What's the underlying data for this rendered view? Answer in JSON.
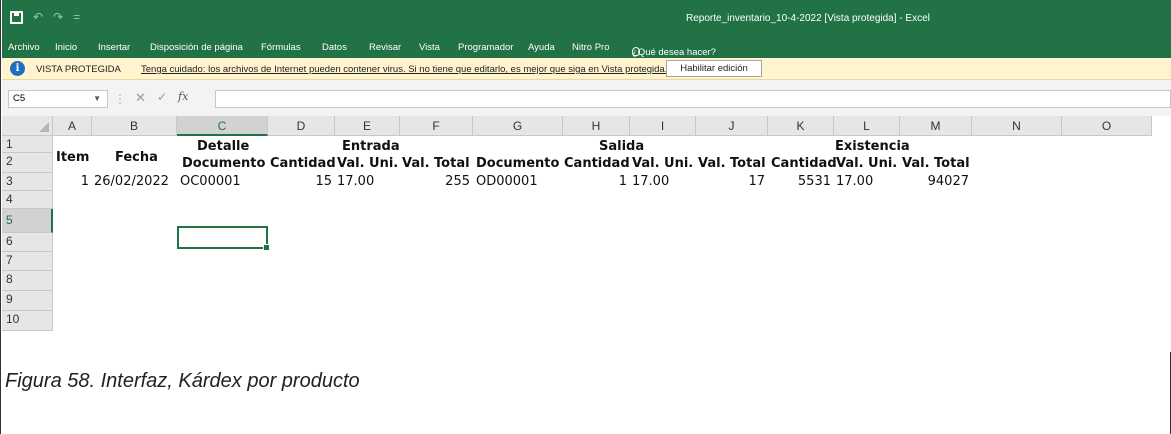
{
  "title_bar": {
    "document_title": "Reporte_inventario_10-4-2022  [Vista protegida]  -  Excel",
    "qat_undo": "↶",
    "qat_redo": "↷",
    "qat_more": "="
  },
  "ribbon_tabs": [
    "Archivo",
    "Inicio",
    "Insertar",
    "Disposición de página",
    "Fórmulas",
    "Datos",
    "Revisar",
    "Vista",
    "Programador",
    "Ayuda",
    "Nitro Pro",
    "¿Qué desea hacer?"
  ],
  "protected_view": {
    "label": "VISTA PROTEGIDA",
    "message": "Tenga cuidado: los archivos de Internet pueden contener virus. Si no tiene que editarlo, es mejor que siga en Vista protegida.",
    "button": "Habilitar edición"
  },
  "formula_bar": {
    "name_box": "C5",
    "formula": ""
  },
  "columns": [
    "A",
    "B",
    "C",
    "D",
    "E",
    "F",
    "G",
    "H",
    "I",
    "J",
    "K",
    "L",
    "M",
    "N",
    "O"
  ],
  "rows": [
    "1",
    "2",
    "3",
    "4",
    "5",
    "6",
    "7",
    "8",
    "9",
    "10"
  ],
  "selected_cell": "C5",
  "sheet": {
    "h_item": "Item",
    "h_fecha": "Fecha",
    "h_detalle": "Detalle",
    "h_entrada": "Entrada",
    "h_salida": "Salida",
    "h_existencia": "Existencia",
    "h_documento_1": "Documento",
    "h_cantidad_1": "Cantidad",
    "h_valuni_1": "Val. Uni.",
    "h_valtotal_1": "Val. Total",
    "h_documento_2": "Documento",
    "h_cantidad_2": "Cantidad",
    "h_valuni_2": "Val. Uni.",
    "h_valtotal_2": "Val. Total",
    "h_cantidad_3": "Cantidad",
    "h_valuni_3": "Val. Uni.",
    "h_valtotal_3": "Val. Total",
    "r3_item": "1",
    "r3_fecha": "26/02/2022",
    "r3_doc_entrada": "OC00001",
    "r3_cant_entrada": "15",
    "r3_valuni_entrada": "17.00",
    "r3_valtotal_entrada": "255",
    "r3_doc_salida": "OD00001",
    "r3_cant_salida": "1",
    "r3_valuni_salida": "17.00",
    "r3_valtotal_salida": "17",
    "r3_cant_exist": "5531",
    "r3_valuni_exist": "17.00",
    "r3_valtotal_exist": "94027"
  },
  "caption": "Figura 58. Interfaz, Kárdex por producto",
  "colors": {
    "excel_green": "#217346",
    "protected_bar": "#fff4ce"
  }
}
